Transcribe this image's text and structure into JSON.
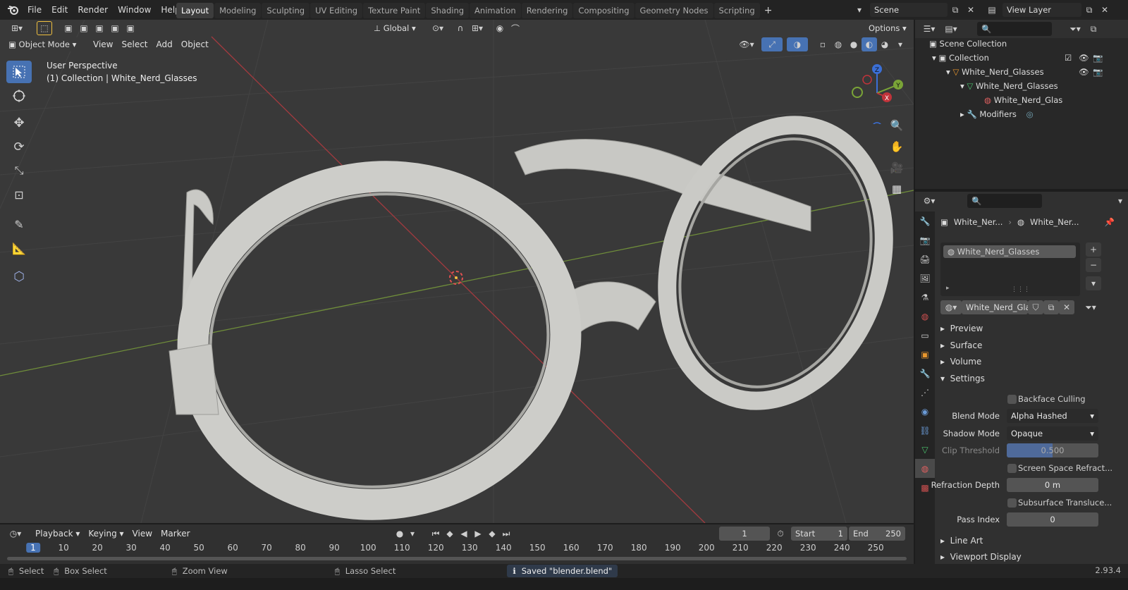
{
  "menus": [
    "File",
    "Edit",
    "Render",
    "Window",
    "Help"
  ],
  "workspaces": [
    "Layout",
    "Modeling",
    "Sculpting",
    "UV Editing",
    "Texture Paint",
    "Shading",
    "Animation",
    "Rendering",
    "Compositing",
    "Geometry Nodes",
    "Scripting"
  ],
  "active_workspace": "Layout",
  "scene": "Scene",
  "view_layer": "View Layer",
  "viewport": {
    "transform_orientation": "Global",
    "options_label": "Options",
    "mode": "Object Mode",
    "menus": [
      "View",
      "Select",
      "Add",
      "Object"
    ],
    "perspective": "User Perspective",
    "collection_info": "(1) Collection | White_Nerd_Glasses",
    "gizmo": {
      "z": "Z",
      "y": "Y",
      "x": "X"
    }
  },
  "outliner": {
    "items": [
      {
        "label": "Scene Collection"
      },
      {
        "label": "Collection"
      },
      {
        "label": "White_Nerd_Glasses"
      },
      {
        "label": "White_Nerd_Glasses"
      },
      {
        "label": "White_Nerd_Glas"
      },
      {
        "label": "Modifiers"
      }
    ]
  },
  "properties": {
    "breadcrumb_object": "White_Ner...",
    "breadcrumb_material": "White_Ner...",
    "slot": "White_Nerd_Glasses",
    "material_name": "White_Nerd_Gla...",
    "panels": {
      "preview": "Preview",
      "surface": "Surface",
      "volume": "Volume",
      "settings": "Settings",
      "line_art": "Line Art",
      "viewport_display": "Viewport Display"
    },
    "backface_culling": "Backface Culling",
    "blend_mode_label": "Blend Mode",
    "blend_mode": "Alpha Hashed",
    "shadow_mode_label": "Shadow Mode",
    "shadow_mode": "Opaque",
    "clip_threshold_label": "Clip Threshold",
    "clip_threshold": "0.500",
    "clip_threshold_fraction": 0.5,
    "screen_space": "Screen Space Refract...",
    "refraction_depth_label": "Refraction Depth",
    "refraction_depth": "0 m",
    "subsurface": "Subsurface Transluce...",
    "pass_index_label": "Pass Index",
    "pass_index": "0"
  },
  "timeline": {
    "menus": [
      "Playback",
      "Keying",
      "View",
      "Marker"
    ],
    "current_frame": "1",
    "start_label": "Start",
    "start": "1",
    "end_label": "End",
    "end": "250",
    "frames": [
      "10",
      "20",
      "30",
      "40",
      "50",
      "60",
      "70",
      "80",
      "90",
      "100",
      "110",
      "120",
      "130",
      "140",
      "150",
      "160",
      "170",
      "180",
      "190",
      "200",
      "210",
      "220",
      "230",
      "240",
      "250"
    ],
    "current_marker": "1"
  },
  "status": {
    "select": "Select",
    "box_select": "Box Select",
    "zoom_view": "Zoom View",
    "lasso_select": "Lasso Select",
    "message": "Saved \"blender.blend\"",
    "version": "2.93.4"
  },
  "colors": {
    "accent": "#4772b3",
    "x_axis": "#c1333a",
    "y_axis": "#7aa437",
    "z_axis": "#3b6fd6"
  }
}
